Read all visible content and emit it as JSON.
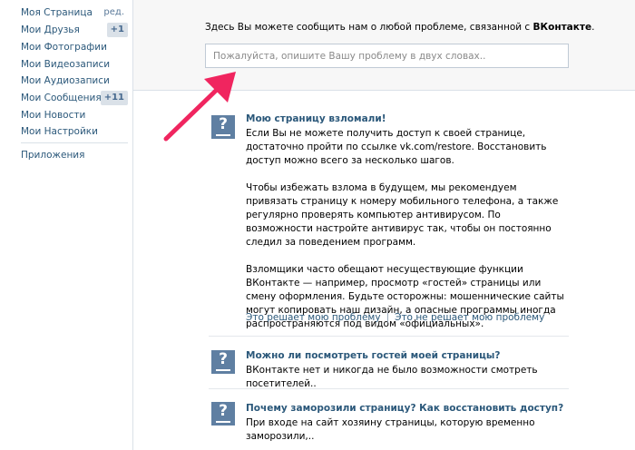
{
  "sidebar": {
    "items": [
      {
        "label": "Моя Страница",
        "extra": "ред."
      },
      {
        "label": "Мои Друзья",
        "badge": "+1"
      },
      {
        "label": "Мои Фотографии"
      },
      {
        "label": "Мои Видеозаписи"
      },
      {
        "label": "Мои Аудиозаписи"
      },
      {
        "label": "Мои Сообщения",
        "badge": "+11"
      },
      {
        "label": "Мои Новости"
      },
      {
        "label": "Мои Настройки"
      }
    ],
    "apps_label": "Приложения"
  },
  "top": {
    "text": "Здесь Вы можете сообщить нам о любой проблеме, связанной с ",
    "brand": "ВКонтакте",
    "text_end": ".",
    "placeholder": "Пожалуйста, опишите Вашу проблему в двух словах.."
  },
  "faq": [
    {
      "title": "Мою страницу взломали!",
      "paragraphs": [
        "Если Вы не можете получить доступ к своей странице, достаточно пройти по ссылке vk.com/restore. Восстановить доступ можно всего за несколько шагов.",
        "Чтобы избежать взлома в будущем, мы рекомендуем привязать страницу к номеру мобильного телефона, а также регулярно проверять компьютер антивирусом. По возможности настройте антивирус так, чтобы он постоянно следил за поведением программ.",
        "Взломщики часто обещают несуществующие функции ВКонтакте — например, просмотр «гостей» страницы или смену оформления. Будьте осторожны: мошеннические сайты могут копировать наш дизайн, а опасные программы иногда распространяются под видом «официальных»."
      ],
      "solves": "Это решает мою проблему",
      "not_solves": "Это не решает мою проблему"
    },
    {
      "title": "Можно ли посмотреть гостей моей страницы?",
      "text": "ВКонтакте нет и никогда не было возможности смотреть посетителей.."
    },
    {
      "title": "Почему заморозили страницу? Как восстановить доступ?",
      "text": "При входе на сайт хозяину страницы, которую временно заморозили,.."
    }
  ],
  "colors": {
    "link": "#2b587a",
    "icon": "#5f7fa2",
    "arrow": "#f0255f",
    "panel": "#f7f7f7"
  },
  "icons": {
    "faq": "question-icon",
    "pointer": "arrow-icon"
  }
}
